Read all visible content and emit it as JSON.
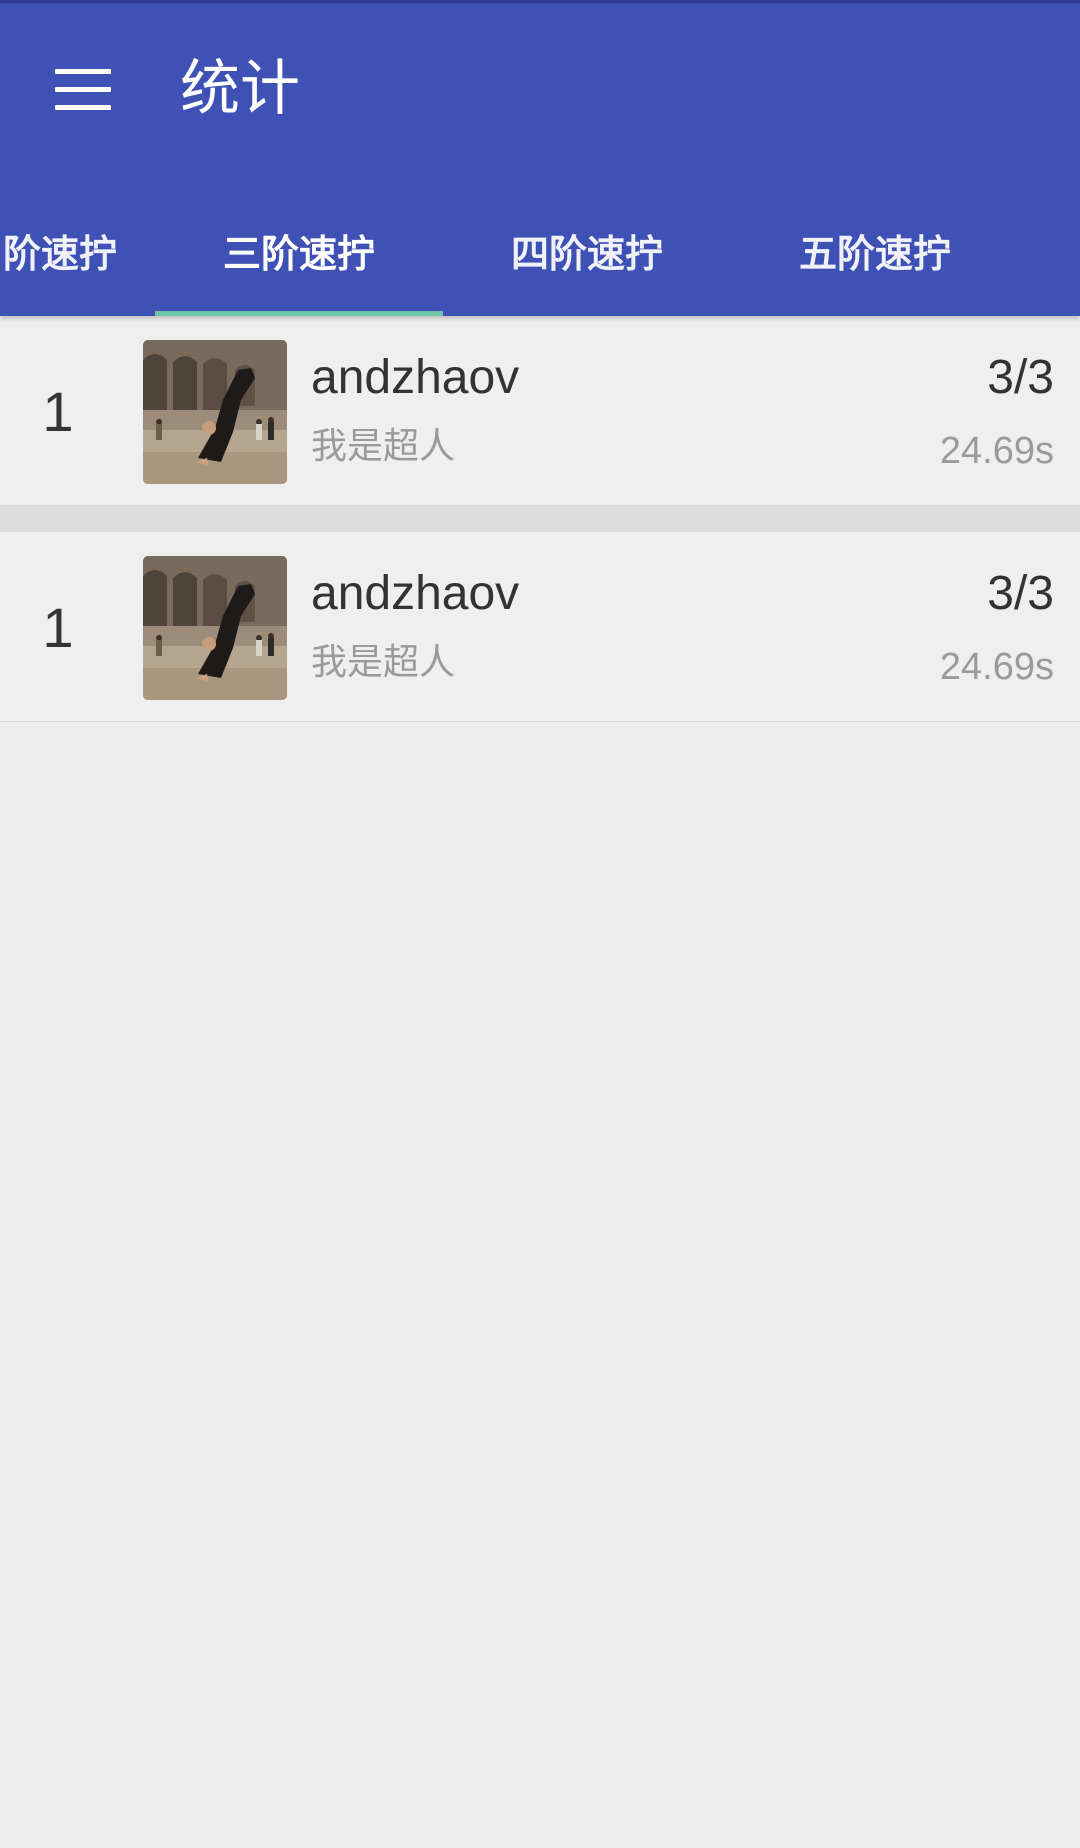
{
  "app": {
    "title": "统计",
    "menu_icon": "hamburger-menu-icon"
  },
  "tabs": [
    {
      "label": "二阶速拧",
      "visible_label": "阶速拧",
      "selected": false
    },
    {
      "label": "三阶速拧",
      "visible_label": "三阶速拧",
      "selected": true
    },
    {
      "label": "四阶速拧",
      "visible_label": "四阶速拧",
      "selected": false
    },
    {
      "label": "五阶速拧",
      "visible_label": "五阶速拧",
      "selected": false
    }
  ],
  "rows": [
    {
      "rank": "1",
      "name": "andzhaov",
      "subtitle": "我是超人",
      "score": "3/3",
      "time": "24.69s"
    },
    {
      "rank": "1",
      "name": "andzhaov",
      "subtitle": "我是超人",
      "score": "3/3",
      "time": "24.69s"
    }
  ],
  "colors": {
    "primary": "#3F51B5",
    "tab_indicator": "#6FC3A6",
    "background": "#EEEEEE",
    "text_primary": "#333333",
    "text_secondary": "#9A9A9A"
  }
}
